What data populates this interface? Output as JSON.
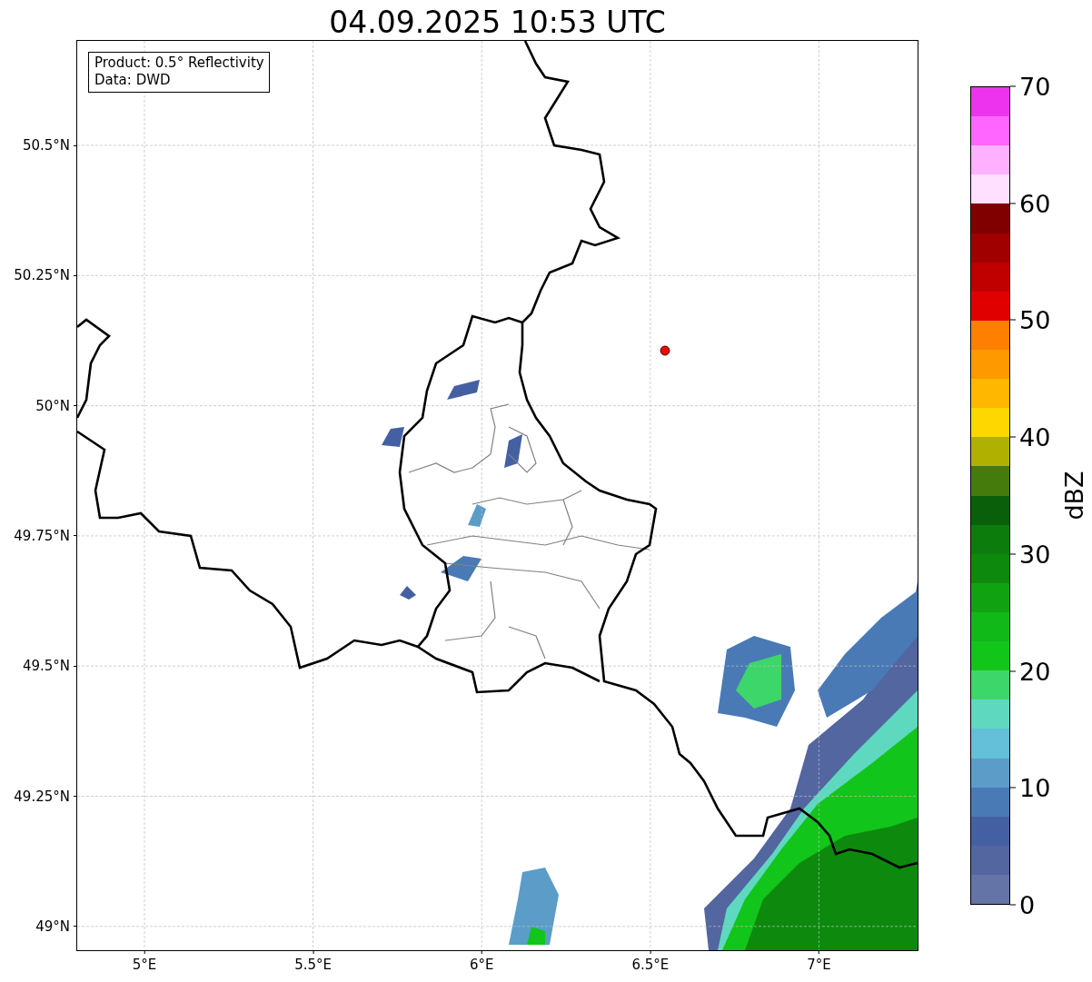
{
  "title": "04.09.2025 10:53 UTC",
  "map": {
    "info_lines": [
      "Product: 0.5° Reflectivity",
      "Data: DWD"
    ],
    "lat_ticks": [
      "50.5°N",
      "50.25°N",
      "50°N",
      "49.75°N",
      "49.5°N",
      "49.25°N",
      "49°N"
    ],
    "lon_ticks": [
      "5°E",
      "5.5°E",
      "6°E",
      "6.5°E",
      "7°E"
    ]
  },
  "colorbar": {
    "label": "dBZ",
    "ticks": [
      "70",
      "60",
      "50",
      "40",
      "30",
      "20",
      "10",
      "0"
    ],
    "bins": [
      {
        "color": "#ee33ee"
      },
      {
        "color": "#ff66ff"
      },
      {
        "color": "#ffb0ff"
      },
      {
        "color": "#ffe0ff"
      },
      {
        "color": "#800000"
      },
      {
        "color": "#a00000"
      },
      {
        "color": "#c00000"
      },
      {
        "color": "#e00000"
      },
      {
        "color": "#ff7f00"
      },
      {
        "color": "#ff9900"
      },
      {
        "color": "#ffb700"
      },
      {
        "color": "#ffd700"
      },
      {
        "color": "#b0b000"
      },
      {
        "color": "#457a0d"
      },
      {
        "color": "#0a600a"
      },
      {
        "color": "#0c7d0c"
      },
      {
        "color": "#0d8a0d"
      },
      {
        "color": "#11a211"
      },
      {
        "color": "#10b818"
      },
      {
        "color": "#12c51a"
      },
      {
        "color": "#3dd66a"
      },
      {
        "color": "#5fd8c0"
      },
      {
        "color": "#63c0d8"
      },
      {
        "color": "#5b9dc8"
      },
      {
        "color": "#4a7ab5"
      },
      {
        "color": "#4560a2"
      },
      {
        "color": "#5366a0"
      },
      {
        "color": "#6574a6"
      }
    ]
  }
}
